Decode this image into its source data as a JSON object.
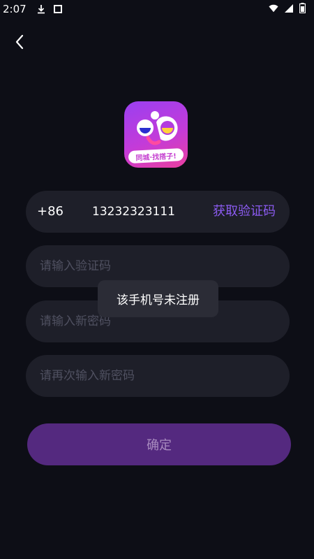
{
  "status_bar": {
    "time": "2:07",
    "icons": [
      "download-icon",
      "box-icon",
      "wifi-icon",
      "signal-icon",
      "battery-icon"
    ]
  },
  "colors": {
    "background": "#0d0e16",
    "field_bg": "#1e1f29",
    "accent": "#8b5bf0",
    "button_bg": "#54297f",
    "placeholder": "#4f5060"
  },
  "logo": {
    "tagline": "同城·找搭子!"
  },
  "phone": {
    "country_code": "+86",
    "number": "13232323111",
    "get_code_label": "获取验证码"
  },
  "code_field": {
    "placeholder": "请输入验证码"
  },
  "new_password_field": {
    "placeholder": "请输入新密码"
  },
  "repeat_password_field": {
    "placeholder": "请再次输入新密码"
  },
  "toast": {
    "message": "该手机号未注册"
  },
  "confirm_button": {
    "label": "确定"
  }
}
